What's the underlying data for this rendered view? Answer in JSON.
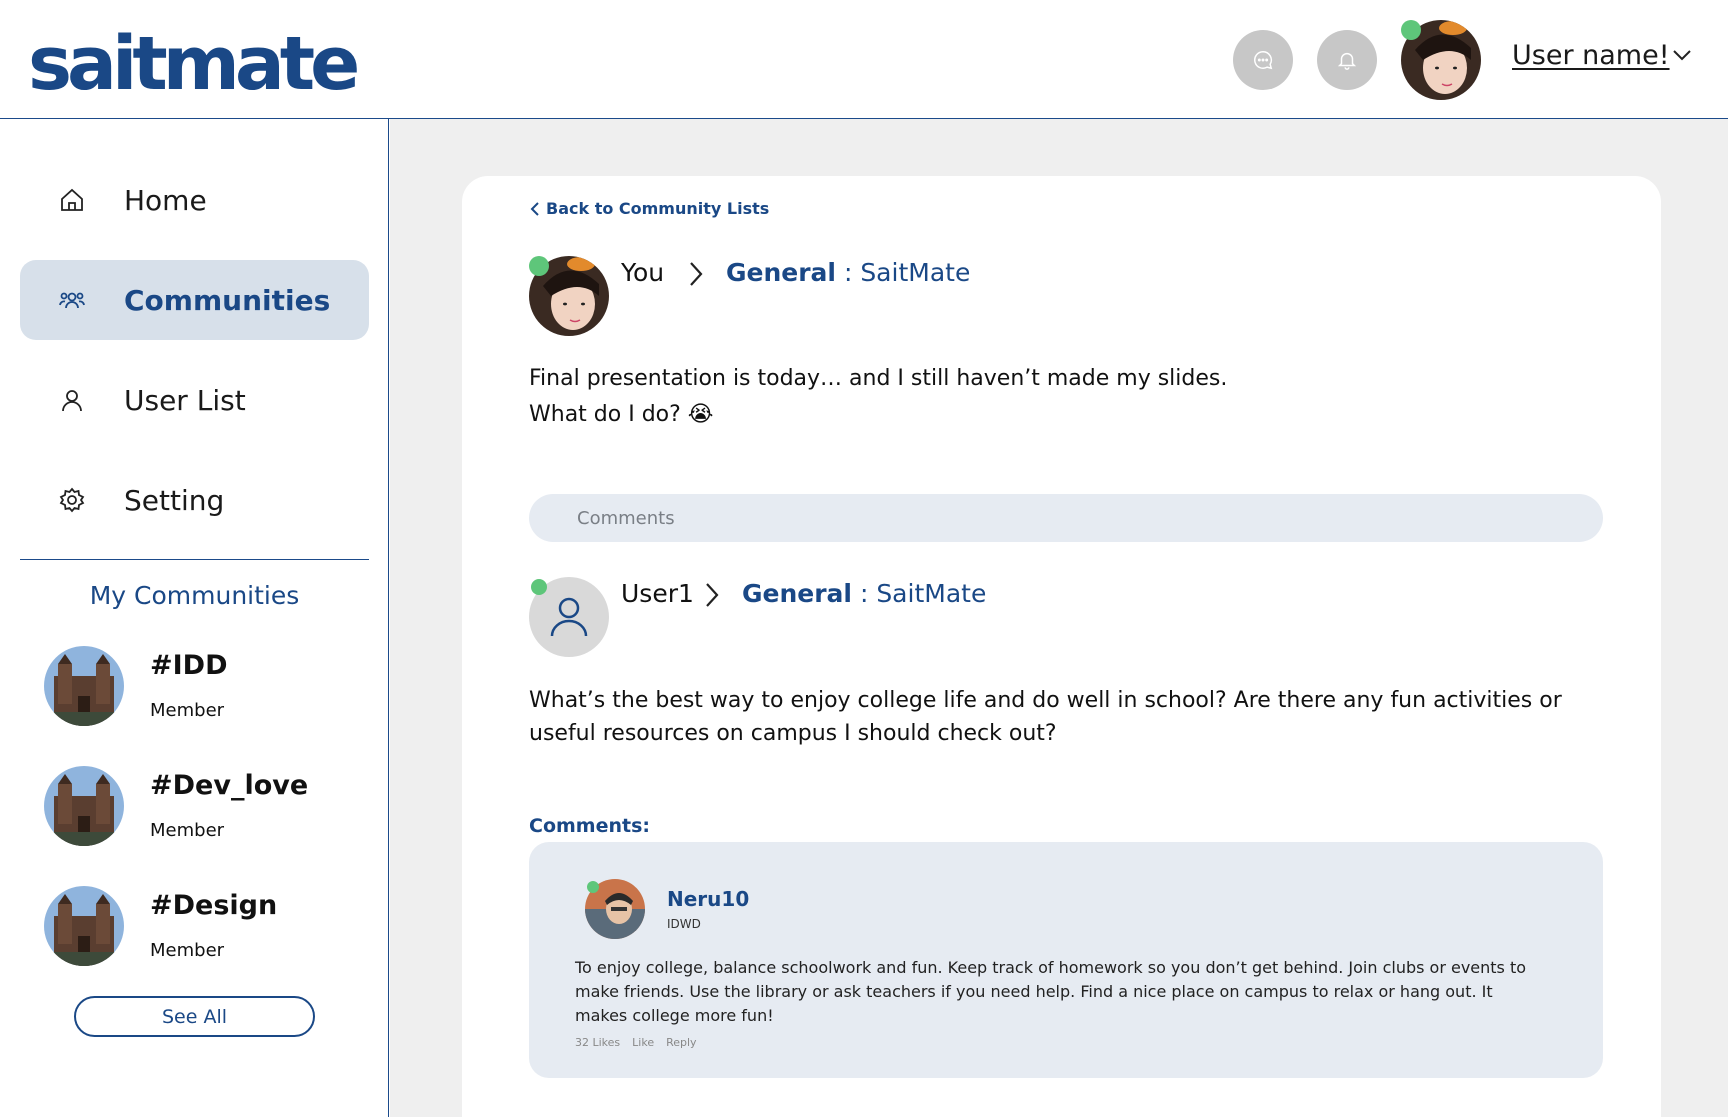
{
  "header": {
    "logo": "saitmate",
    "user_name": "User name!",
    "icons": [
      "chat-icon",
      "bell-icon",
      "chevron-down-icon"
    ]
  },
  "sidebar": {
    "nav": [
      {
        "label": "Home",
        "icon": "home-icon",
        "active": false
      },
      {
        "label": "Communities",
        "icon": "users-icon",
        "active": true
      },
      {
        "label": "User List",
        "icon": "user-icon",
        "active": false
      },
      {
        "label": "Setting",
        "icon": "gear-icon",
        "active": false
      }
    ],
    "my_communities_title": "My Communities",
    "communities": [
      {
        "name": "#IDD",
        "role": "Member"
      },
      {
        "name": "#Dev_love",
        "role": "Member"
      },
      {
        "name": "#Design",
        "role": "Member"
      }
    ],
    "see_all": "See All"
  },
  "post": {
    "back_link": "Back to Community Lists",
    "author": "You",
    "channel_bold": "General",
    "channel_rest": " : SaitMate",
    "body_line1": "Final presentation is today… and I still haven’t made my slides.",
    "body_line2": "What do I do? 😭"
  },
  "comment_input": {
    "placeholder": "Comments"
  },
  "thread": {
    "author": "User1",
    "channel_bold": "General",
    "channel_rest": " : SaitMate",
    "body": "What’s the best way to enjoy college life and do well in school? Are there any fun activities or useful resources on campus I should check out?",
    "comments_label": "Comments:",
    "comment": {
      "author": "Neru10",
      "sub": "IDWD",
      "text": "To enjoy college, balance schoolwork and fun. Keep track of homework so you don’t get behind. Join clubs or events to make friends. Use the library or ask teachers if you need help. Find a nice place on campus to relax or hang out. It makes college more fun!",
      "likes": "32 Likes",
      "like_action": "Like",
      "reply_action": "Reply"
    }
  },
  "colors": {
    "brand": "#1a4886",
    "online": "#5ec67a",
    "active_nav_bg": "#d7e0ea",
    "comment_bg": "#e6ebf2",
    "main_bg": "#efefef"
  }
}
